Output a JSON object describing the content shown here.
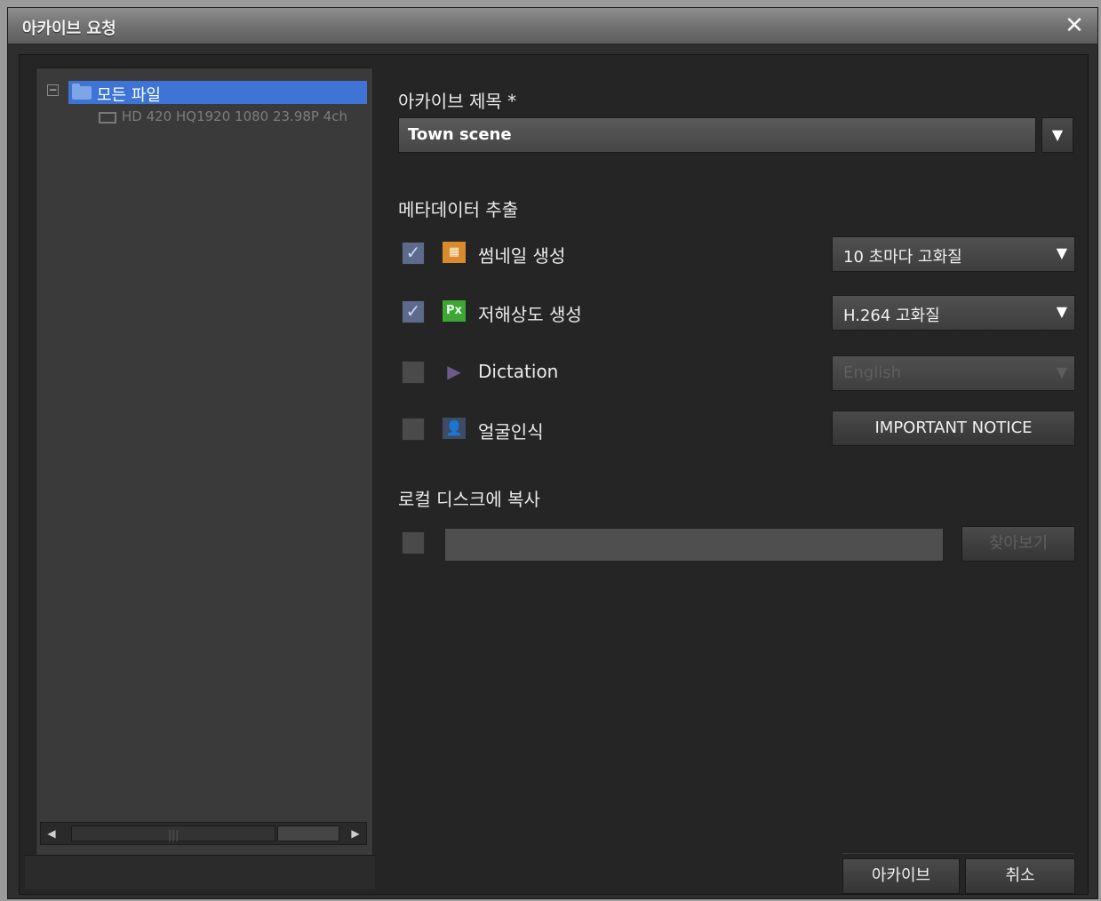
{
  "window": {
    "title": "아카이브 요청",
    "close_symbol": "✕"
  },
  "tree": {
    "expander_symbol": "−",
    "root_label": "모든 파일",
    "child_label": "HD 420 HQ1920 1080 23.98P 4ch"
  },
  "scrollbar": {
    "left_arrow": "◀",
    "right_arrow": "▶",
    "grip": "|||"
  },
  "archive_title": {
    "label": "아카이브 제목 *",
    "value": "Town scene",
    "arrow": "▼"
  },
  "metadata": {
    "heading": "메타데이터 추출",
    "items": [
      {
        "label": "썸네일 생성",
        "checked": true,
        "check_symbol": "✓",
        "icon_text": "▦",
        "icon": "thumbnail-icon",
        "option": "10 초마다 고화질",
        "option_arrow": "▼",
        "enabled": true
      },
      {
        "label": "저해상도 생성",
        "checked": true,
        "check_symbol": "✓",
        "icon_text": "Px",
        "icon": "proxy-px-icon",
        "option": "H.264 고화질",
        "option_arrow": "▼",
        "enabled": true
      },
      {
        "label": "Dictation",
        "checked": false,
        "check_symbol": "",
        "icon_text": "▶",
        "icon": "dictation-icon",
        "option": "English",
        "option_arrow": "▼",
        "enabled": false
      },
      {
        "label": "얼굴인식",
        "checked": false,
        "check_symbol": "",
        "icon_text": "👤",
        "icon": "face-icon",
        "button": "IMPORTANT NOTICE"
      }
    ]
  },
  "local_copy": {
    "heading": "로컬 디스크에 복사",
    "checked": false,
    "path_value": "",
    "browse_label": "찾아보기"
  },
  "footer": {
    "archive_label": "아카이브",
    "cancel_label": "취소"
  }
}
